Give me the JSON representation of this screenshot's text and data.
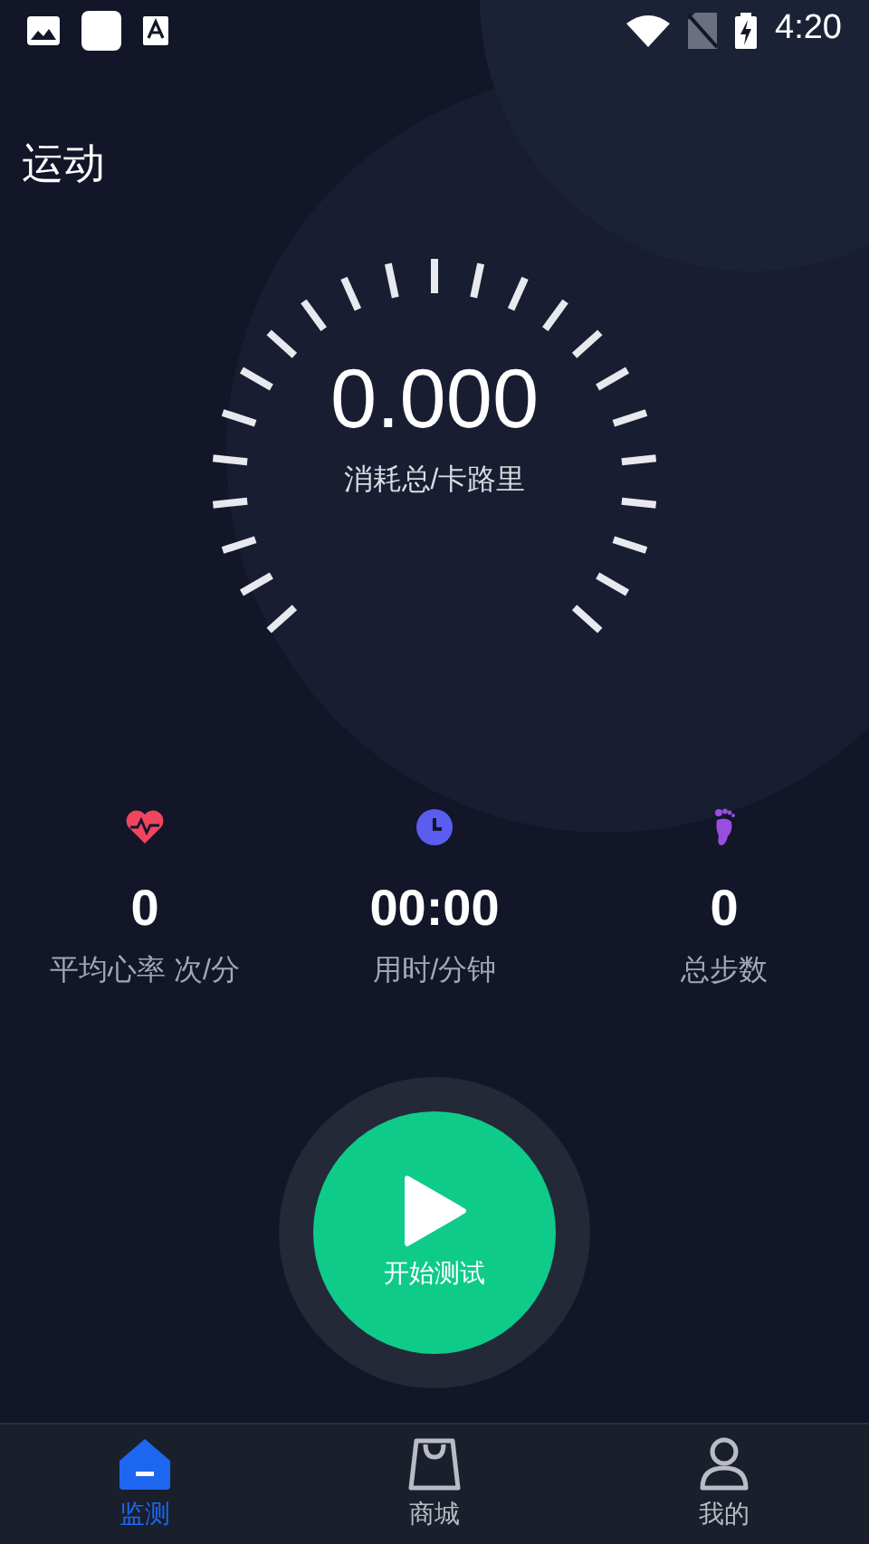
{
  "status_bar": {
    "time": "4:20"
  },
  "title": "运动",
  "gauge": {
    "value": "0.000",
    "label": "消耗总/卡路里"
  },
  "stats": [
    {
      "kind": "heart",
      "value": "0",
      "label": "平均心率 次/分"
    },
    {
      "kind": "clock",
      "value": "00:00",
      "label": "用时/分钟"
    },
    {
      "kind": "foot",
      "value": "0",
      "label": "总步数"
    }
  ],
  "start_button": {
    "label": "开始测试"
  },
  "tabs": [
    {
      "kind": "home",
      "label": "监测",
      "selected": true
    },
    {
      "kind": "bag",
      "label": "商城",
      "selected": false
    },
    {
      "kind": "person",
      "label": "我的",
      "selected": false
    }
  ]
}
